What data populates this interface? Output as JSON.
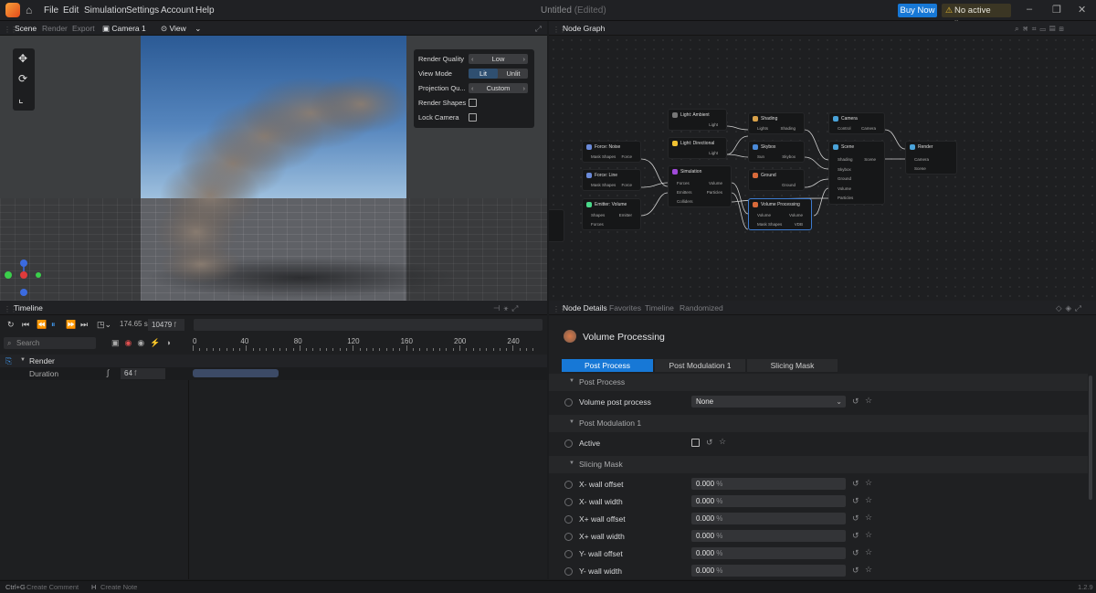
{
  "menu": [
    "File",
    "Edit",
    "Simulation",
    "Settings",
    "Account",
    "Help"
  ],
  "document": {
    "name": "Untitled",
    "suffix": "(Edited)"
  },
  "buy_now": "Buy Now",
  "license": "No active license",
  "scene_panel": {
    "tabs": [
      "Scene",
      "Render",
      "Export"
    ],
    "camera": "Camera 1",
    "view": "View"
  },
  "render_settings": {
    "quality_label": "Render Quality",
    "quality_value": "Low",
    "view_mode_label": "View Mode",
    "view_mode_options": [
      "Lit",
      "Unlit"
    ],
    "view_mode_selected": "Lit",
    "projection_label": "Projection Qu...",
    "projection_value": "Custom",
    "render_shapes_label": "Render Shapes",
    "lock_camera_label": "Lock Camera"
  },
  "node_graph": {
    "title": "Node Graph",
    "nodes": [
      {
        "title": "Light: Ambient",
        "ports": [
          "Light"
        ]
      },
      {
        "title": "Light: Directional",
        "ports": [
          "Light"
        ]
      },
      {
        "title": "Shading",
        "ports": [
          "Lights",
          "Shading"
        ]
      },
      {
        "title": "Camera",
        "ports": [
          "Control",
          "Camera"
        ]
      },
      {
        "title": "Force: Noise",
        "ports": [
          "Mask Shapes",
          "Force"
        ]
      },
      {
        "title": "Skybox",
        "ports": [
          "Sun",
          "Skybox"
        ]
      },
      {
        "title": "Scene",
        "ports": [
          "Shading",
          "Scene",
          "Skybox",
          "Ground",
          "Volume",
          "Particles"
        ]
      },
      {
        "title": "Render",
        "ports": [
          "Camera",
          "Scene"
        ]
      },
      {
        "title": "Simulation",
        "ports": [
          "Forces",
          "Volume",
          "Emitters",
          "Particles",
          "Colliders"
        ]
      },
      {
        "title": "Force: Line",
        "ports": [
          "Mask Shapes",
          "Force"
        ]
      },
      {
        "title": "Ground",
        "ports": [
          "Ground"
        ]
      },
      {
        "title": "Emitter: Volume",
        "ports": [
          "Shapes",
          "Emitter",
          "Forces"
        ]
      },
      {
        "title": "Volume Processing",
        "ports": [
          "Volume",
          "Volume",
          "Mask Shapes",
          "VDB"
        ]
      }
    ]
  },
  "timeline": {
    "title": "Timeline",
    "time": "174.65",
    "time_unit": "s",
    "frame": "10479",
    "frame_unit": "f",
    "search_placeholder": "Search",
    "ruler": [
      "0",
      "40",
      "80",
      "120",
      "160",
      "200",
      "240"
    ],
    "track": "Render",
    "property": "Duration",
    "duration": "64",
    "duration_unit": "f"
  },
  "details": {
    "tabs": [
      "Node Details",
      "Favorites",
      "Timeline",
      "Randomized"
    ],
    "node_title": "Volume Processing",
    "subtabs": [
      "Post Process",
      "Post Modulation 1",
      "Slicing Mask"
    ],
    "sec_post": "Post Process",
    "vpp_label": "Volume post process",
    "vpp_value": "None",
    "sec_mod": "Post Modulation 1",
    "active_label": "Active",
    "sec_slice": "Slicing Mask",
    "rows": [
      {
        "label": "X- wall offset",
        "value": "0.000",
        "unit": "%"
      },
      {
        "label": "X- wall width",
        "value": "0.000",
        "unit": "%"
      },
      {
        "label": "X+ wall offset",
        "value": "0.000",
        "unit": "%"
      },
      {
        "label": "X+ wall width",
        "value": "0.000",
        "unit": "%"
      },
      {
        "label": "Y- wall offset",
        "value": "0.000",
        "unit": "%"
      },
      {
        "label": "Y- wall width",
        "value": "0.000",
        "unit": "%"
      }
    ]
  },
  "status": {
    "k1": "Ctrl+G",
    "t1": "Create Comment",
    "k2": "H",
    "t2": "Create Note",
    "version": "1.2.9"
  }
}
